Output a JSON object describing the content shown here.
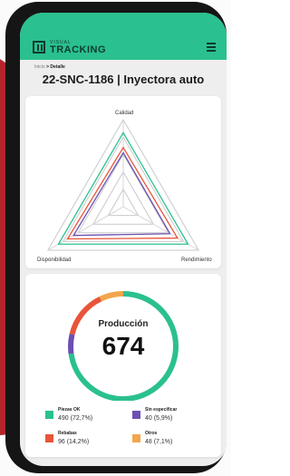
{
  "app": {
    "brand_small": "VISUAL",
    "brand": "TRACKING"
  },
  "breadcrumb": {
    "home": "Inicio",
    "separator": ">",
    "current": "Detalle"
  },
  "page": {
    "title": "22-SNC-1186 | Inyectora auto"
  },
  "radar": {
    "axes": [
      "Calidad",
      "Rendimiento",
      "Disponibilidad"
    ],
    "series": [
      {
        "color": "#2ac08f",
        "values": [
          0.85,
          0.86,
          0.86
        ]
      },
      {
        "color": "#e8553a",
        "values": [
          0.68,
          0.72,
          0.74
        ]
      },
      {
        "color": "#6c4fb3",
        "values": [
          0.62,
          0.62,
          0.66
        ]
      }
    ]
  },
  "production": {
    "label": "Producción",
    "value": "674",
    "ring": [
      {
        "name": "Piezas OK",
        "fraction": 0.727,
        "color": "#2ac08f"
      },
      {
        "name": "Sin especificar",
        "fraction": 0.059,
        "color": "#6c4fb3"
      },
      {
        "name": "Rebabas",
        "fraction": 0.142,
        "color": "#e8553a"
      },
      {
        "name": "Otros",
        "fraction": 0.071,
        "color": "#f3a64b"
      }
    ],
    "legend": [
      {
        "name": "Piezas OK",
        "value": "490 (72,7%)",
        "color": "#2ac08f"
      },
      {
        "name": "Sin especificar",
        "value": "40 (5,9%)",
        "color": "#6c4fb3"
      },
      {
        "name": "Rebabas",
        "value": "96 (14,2%)",
        "color": "#e8553a"
      },
      {
        "name": "Otros",
        "value": "48 (7,1%)",
        "color": "#f3a64b"
      }
    ]
  }
}
